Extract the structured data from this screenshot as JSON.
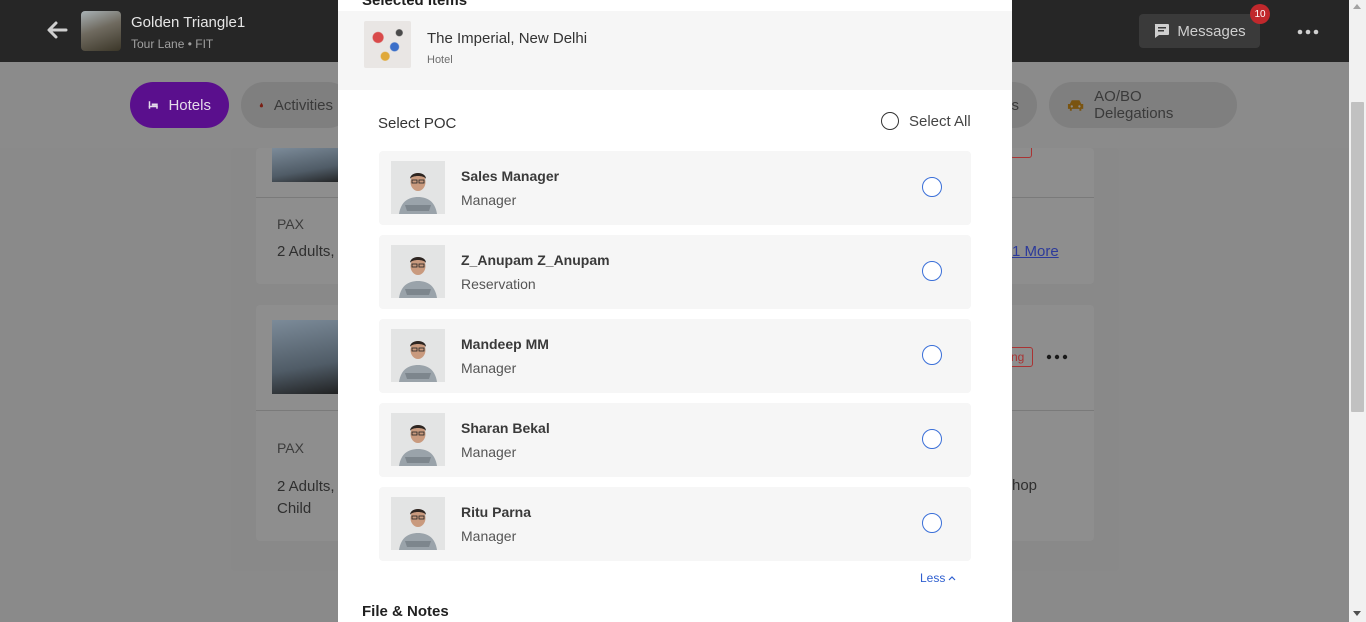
{
  "header": {
    "trip_title": "Golden Triangle1",
    "trip_subtitle": "Tour Lane • FIT",
    "messages_label": "Messages",
    "messages_count": "10"
  },
  "tabs": [
    {
      "label": "Hotels",
      "icon": "bed-icon",
      "active": true
    },
    {
      "label": "Activities",
      "icon": "flame-icon",
      "active": false
    },
    {
      "label": "es",
      "active": false
    },
    {
      "label": "AO/BO Delegations",
      "icon": "car-icon",
      "active": false
    }
  ],
  "background": {
    "card1": {
      "pax_label": "PAX",
      "pax_value": "2 Adults,",
      "more_link": "1 More"
    },
    "card2": {
      "pax_label": "PAX",
      "pax_value_line1": "2 Adults,",
      "pax_value_line2": "Child",
      "tag": "ng",
      "right_text": "hop"
    }
  },
  "modal": {
    "selected_items_title": "Selected Items",
    "selected_item": {
      "name": "The Imperial, New Delhi",
      "type": "Hotel"
    },
    "select_poc_label": "Select POC",
    "select_all_label": "Select All",
    "pocs": [
      {
        "name": "Sales Manager",
        "role": "Manager"
      },
      {
        "name": "Z_Anupam Z_Anupam",
        "role": "Reservation"
      },
      {
        "name": "Mandeep MM",
        "role": "Manager"
      },
      {
        "name": "Sharan Bekal",
        "role": "Manager"
      },
      {
        "name": "Ritu Parna",
        "role": "Manager"
      }
    ],
    "less_label": "Less",
    "files_notes_title": "File & Notes"
  },
  "colors": {
    "accent_purple": "#5a0f8d",
    "radio_blue": "#3a6fd8",
    "link_blue": "#2f5fd0",
    "badge_red": "#c0282c"
  }
}
